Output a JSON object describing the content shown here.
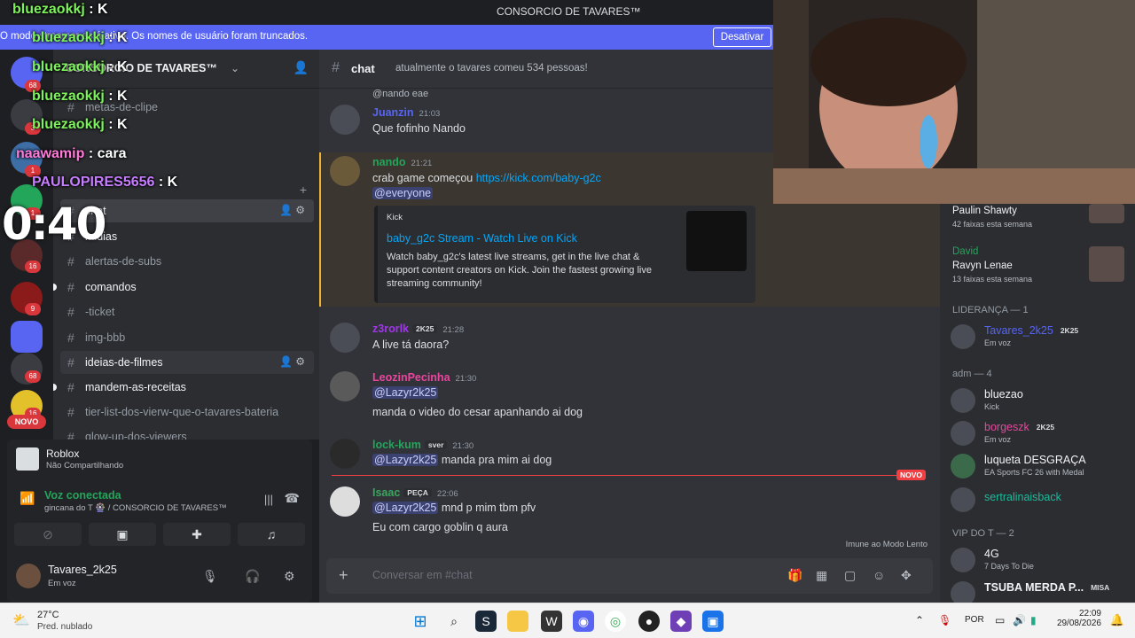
{
  "titlebar": {
    "title": "CONSORCIO DE TAVARES™"
  },
  "streamer_banner": {
    "message": "O modo streamer está ativo. Os nomes de usuário foram truncados.",
    "button": "Desativar"
  },
  "rail_badges": [
    "68",
    "3",
    "1",
    "1",
    "16",
    "9",
    "68",
    "16"
  ],
  "rail_new": "NOVO",
  "server": {
    "name": "CONSORCIO DE TAVARES™"
  },
  "channels": [
    {
      "name": "metas-de-clipe",
      "state": "muted"
    },
    {
      "name": "chat",
      "state": "selected"
    },
    {
      "name": "midias",
      "state": "normal"
    },
    {
      "name": "alertas-de-subs",
      "state": "muted"
    },
    {
      "name": "comandos",
      "state": "unread"
    },
    {
      "name": "-ticket",
      "state": "muted"
    },
    {
      "name": "img-bbb",
      "state": "muted"
    },
    {
      "name": "ideias-de-filmes",
      "state": "hover"
    },
    {
      "name": "mandem-as-receitas",
      "state": "unread"
    },
    {
      "name": "tier-list-dos-vierw-que-o-tavares-bateria",
      "state": "muted"
    },
    {
      "name": "glow-up-dos-viewers",
      "state": "muted"
    }
  ],
  "activity": {
    "game": "Roblox",
    "status": "Não Compartilhando"
  },
  "voice": {
    "status": "Voz conectada",
    "channel": "gincana do T 🎡 / CONSORCIO DE TAVARES™"
  },
  "user": {
    "name": "Tavares_2k25",
    "status": "Em voz"
  },
  "chat_header": {
    "channel": "chat",
    "topic": "atualmente o tavares comeu 534 pessoas!"
  },
  "messages": [
    {
      "reply": "@nando eae",
      "author": "Juanzin",
      "time": "21:03",
      "color": "#5865f2",
      "lines": [
        "Que fofinho Nando"
      ]
    },
    {
      "author": "nando",
      "time": "21:21",
      "color": "#23a55a",
      "link": "https://kick.com/baby-g2c",
      "line_prefix": "crab game começou ",
      "mention": "@everyone"
    },
    {
      "author": "z3rorlk",
      "tag": "2K25",
      "time": "21:28",
      "color": "#a335ee",
      "lines": [
        "A live tá daora?"
      ]
    },
    {
      "author": "LeozinPecinha",
      "tag": "",
      "time": "21:30",
      "color": "#eb459e",
      "mention": "@Lazyr2k25",
      "lines": [
        "manda o video do cesar apanhando ai dog"
      ]
    },
    {
      "author": "lock-kum",
      "tag": "sver",
      "time": "21:30",
      "color": "#23a55a",
      "mention": "@Lazyr2k25",
      "lines": [
        "manda pra mim ai dog"
      ]
    },
    {
      "author": "Isaac",
      "tag": "PEÇA",
      "time": "22:06",
      "color": "#3ba55d",
      "mention": "@Lazyr2k25",
      "lines": [
        "mnd p mim tbm pfv",
        "Eu com cargo goblin q aura"
      ]
    }
  ],
  "embed": {
    "provider": "Kick",
    "title": "baby_g2c Stream - Watch Live on Kick",
    "description": "Watch baby_g2c's latest live streams, get in the live chat & support content creators on Kick. Join the fastest growing live streaming community!"
  },
  "new_label": "NOVO",
  "slowmode": "Imune ao Modo Lento",
  "composer": {
    "placeholder": "Conversar em #chat"
  },
  "members": {
    "music": [
      {
        "l1": "Paulin Shawty",
        "l2": "",
        "l3": "42 faixas esta semana"
      },
      {
        "l1": "David",
        "l2": "Ravyn Lenae",
        "l3": "13 faixas esta semana"
      }
    ],
    "groups": [
      {
        "header": "LIDERANÇA — 1",
        "members": [
          {
            "name": "Tavares_2k25",
            "tag": "2K25",
            "status": "Em voz",
            "color": "#5865f2"
          }
        ]
      },
      {
        "header": "adm — 4",
        "members": [
          {
            "name": "bluezao",
            "tag": "",
            "status": "Kick",
            "color": "#f2f3f5"
          },
          {
            "name": "borgeszk",
            "tag": "2K25",
            "status": "Em voz",
            "color": "#eb459e"
          },
          {
            "name": "luqueta DESGRAÇA",
            "tag": "",
            "status": "EA Sports FC 26 with Medal",
            "color": "#f2f3f5"
          },
          {
            "name": "sertralinaisback",
            "tag": "",
            "status": "",
            "color": "#1abc9c"
          }
        ]
      },
      {
        "header": "VIP DO T — 2",
        "members": [
          {
            "name": "4G",
            "tag": "",
            "status": "7 Days To Die",
            "color": "#f2f3f5"
          },
          {
            "name": "TSUBA MERDA P...",
            "tag": "MISA",
            "status": "",
            "color": "#f2f3f5"
          }
        ]
      }
    ]
  },
  "overlay_chat": [
    {
      "user": "bluezaokkj",
      "msg": ": K",
      "color": "#7cf25b"
    },
    {
      "user": "bluezaokkj",
      "msg": ": K",
      "color": "#7cf25b"
    },
    {
      "user": "bluezaokkj",
      "msg": ": K",
      "color": "#7cf25b"
    },
    {
      "user": "bluezaokkj",
      "msg": ": K",
      "color": "#7cf25b"
    },
    {
      "user": "bluezaokkj",
      "msg": ": K",
      "color": "#7cf25b"
    },
    {
      "user": "naawamip",
      "msg": ": cara",
      "color": "#ff7ad9"
    },
    {
      "user": "PAULOPIRES5656",
      "msg": ": K",
      "color": "#c77dff"
    }
  ],
  "timer": "0:40",
  "taskbar": {
    "temp": "27°C",
    "weather": "Pred. nublado",
    "lang": "POR",
    "time": "22:09",
    "date": "29/08/2026"
  }
}
